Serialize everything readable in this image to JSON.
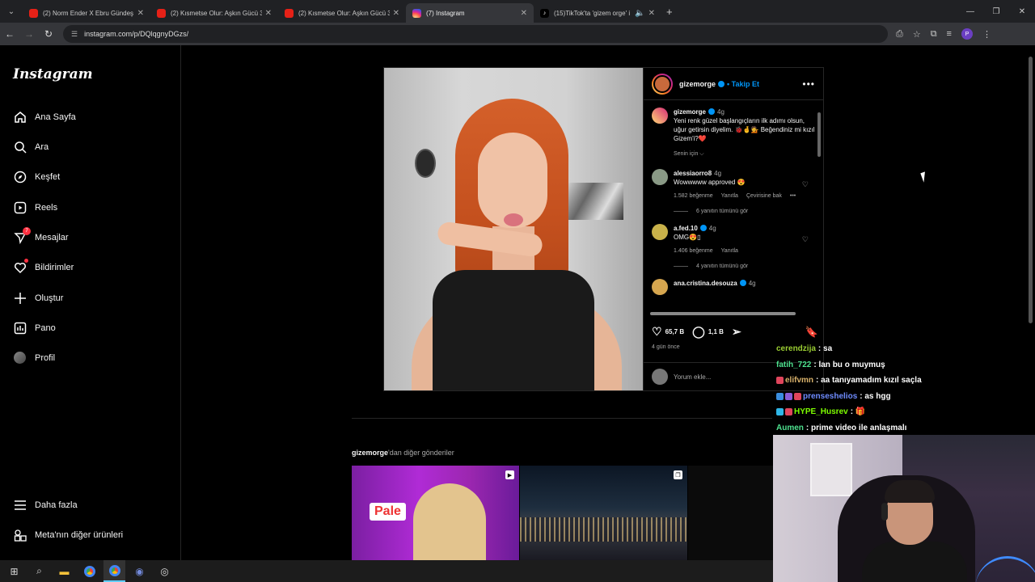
{
  "browser": {
    "tabs": [
      {
        "title": "(2) Norm Ender X Ebru Gündeş",
        "icon": "youtube-icon",
        "active": false
      },
      {
        "title": "(2) Kısmetse Olur: Aşkın Gücü 3",
        "icon": "youtube-icon",
        "active": false
      },
      {
        "title": "(2) Kısmetse Olur: Aşkın Gücü 3",
        "icon": "youtube-icon",
        "active": false
      },
      {
        "title": "(7) Instagram",
        "icon": "instagram-icon",
        "active": true
      },
      {
        "title": "(15)TikTok'ta 'gizem orge' i",
        "icon": "tiktok-icon",
        "active": false
      }
    ],
    "url": "instagram.com/p/DQlqgnyDGzs/",
    "profile_initial": "P"
  },
  "sidebar": {
    "logo": "Instagram",
    "items": [
      {
        "label": "Ana Sayfa",
        "icon": "home-icon"
      },
      {
        "label": "Ara",
        "icon": "search-icon"
      },
      {
        "label": "Keşfet",
        "icon": "compass-icon"
      },
      {
        "label": "Reels",
        "icon": "reels-icon"
      },
      {
        "label": "Mesajlar",
        "icon": "messenger-icon",
        "badge": "7"
      },
      {
        "label": "Bildirimler",
        "icon": "heart-icon"
      },
      {
        "label": "Oluştur",
        "icon": "plus-icon"
      },
      {
        "label": "Pano",
        "icon": "dashboard-icon"
      },
      {
        "label": "Profil",
        "icon": "avatar"
      }
    ],
    "more": "Daha fazla",
    "meta": "Meta'nın diğer ürünleri"
  },
  "post": {
    "username": "gizemorge",
    "follow": "• Takip Et",
    "caption": {
      "username": "gizemorge",
      "time": "4g",
      "text": "Yeni renk güzel başlangıçların ilk adımı olsun, uğur getirsin diyelim. 🐞🤞💁 Beğendiniz mi kızıl Gizem'i?❤️"
    },
    "for_you": "Senin için ⌵",
    "comments": [
      {
        "username": "alessiaorro8",
        "time": "4g",
        "text": "Wowwwww approved 😍",
        "likes": "1.582 beğenme",
        "reply": "Yanıtla",
        "translate": "Çevirisine bak",
        "replies": "6 yanıtın tümünü gör"
      },
      {
        "username": "a.fed.10",
        "time": "4g",
        "text": "OMG😍▯",
        "likes": "1.406 beğenme",
        "reply": "Yanıtla",
        "replies": "4 yanıtın tümünü gör"
      },
      {
        "username": "ana.cristina.desouza",
        "time": "4g"
      }
    ],
    "likes_count": "65,7 B",
    "comments_count": "1,1 B",
    "posted_ago": "4 gün önce",
    "add_comment_placeholder": "Yorum ekle..."
  },
  "more_posts": {
    "username": "gizemorge",
    "suffix": "'dan diğer gönderiler",
    "thumb1_text": "Pale"
  },
  "chat": [
    {
      "user": "cerendzija",
      "color": "#9acd32",
      "msg": ": sa",
      "badges": []
    },
    {
      "user": "fatih_722",
      "color": "#4ee28f",
      "msg": ": lan bu o muymuş",
      "badges": []
    },
    {
      "user": "elifvmn",
      "color": "#d9b26b",
      "msg": ": aa tanıyamadım kızıl saçla",
      "badges": [
        "#e0455c"
      ]
    },
    {
      "user": "prenseshelios",
      "color": "#6f8cff",
      "msg": ": as hgg",
      "badges": [
        "#3a8dde",
        "#8a5cd6",
        "#e0455c"
      ]
    },
    {
      "user": "HYPE_Husrev",
      "color": "#7fff00",
      "msg": ": 🎁",
      "badges": [
        "#2fb7e8",
        "#e0455c"
      ]
    },
    {
      "user": "Aumen",
      "color": "#4ee28f",
      "msg": ": prime video ile anlaşmalı",
      "badges": []
    }
  ],
  "colors": {
    "accent": "#0095f6",
    "notification": "#ff3040"
  }
}
